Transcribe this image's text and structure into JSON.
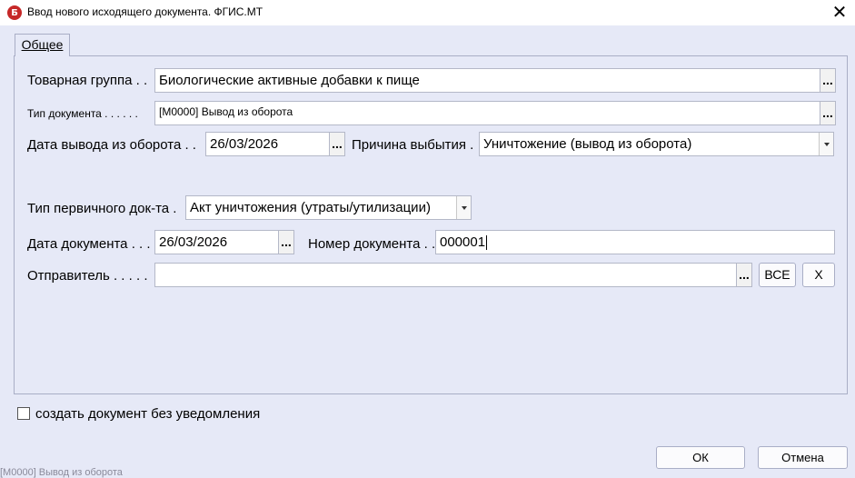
{
  "window": {
    "title": "Ввод нового исходящего документа. ФГИС.МТ",
    "icon_letter": "Б",
    "close_symbol": "✕"
  },
  "tabs": [
    {
      "label": "Общее"
    }
  ],
  "form": {
    "product_group": {
      "label": "Товарная группа . .",
      "value": "Биологические активные добавки к пище"
    },
    "doc_type": {
      "label": "Тип документа . . . . . .",
      "value": "[М0000] Вывод из оборота"
    },
    "withdraw_date": {
      "label": "Дата вывода из оборота . .",
      "value": "26/03/2026"
    },
    "reason": {
      "label": "Причина выбытия .",
      "value": "Уничтожение (вывод из оборота)"
    },
    "primary_doc_type": {
      "label": "Тип первичного док-та .",
      "value": "Акт уничтожения (утраты/утилизации)"
    },
    "doc_date": {
      "label": "Дата документа . . .",
      "value": "26/03/2026"
    },
    "doc_number": {
      "label": "Номер документа . .",
      "value": "000001"
    },
    "sender": {
      "label": "Отправитель . . . . .",
      "value": ""
    },
    "dots_label": "...",
    "all_button": "ВСЕ",
    "clear_button": "X"
  },
  "checkbox": {
    "label": "создать документ без уведомления",
    "checked": false
  },
  "buttons": {
    "ok": "ОК",
    "cancel": "Отмена"
  },
  "status_text": "[М0000] Вывод из оборота"
}
